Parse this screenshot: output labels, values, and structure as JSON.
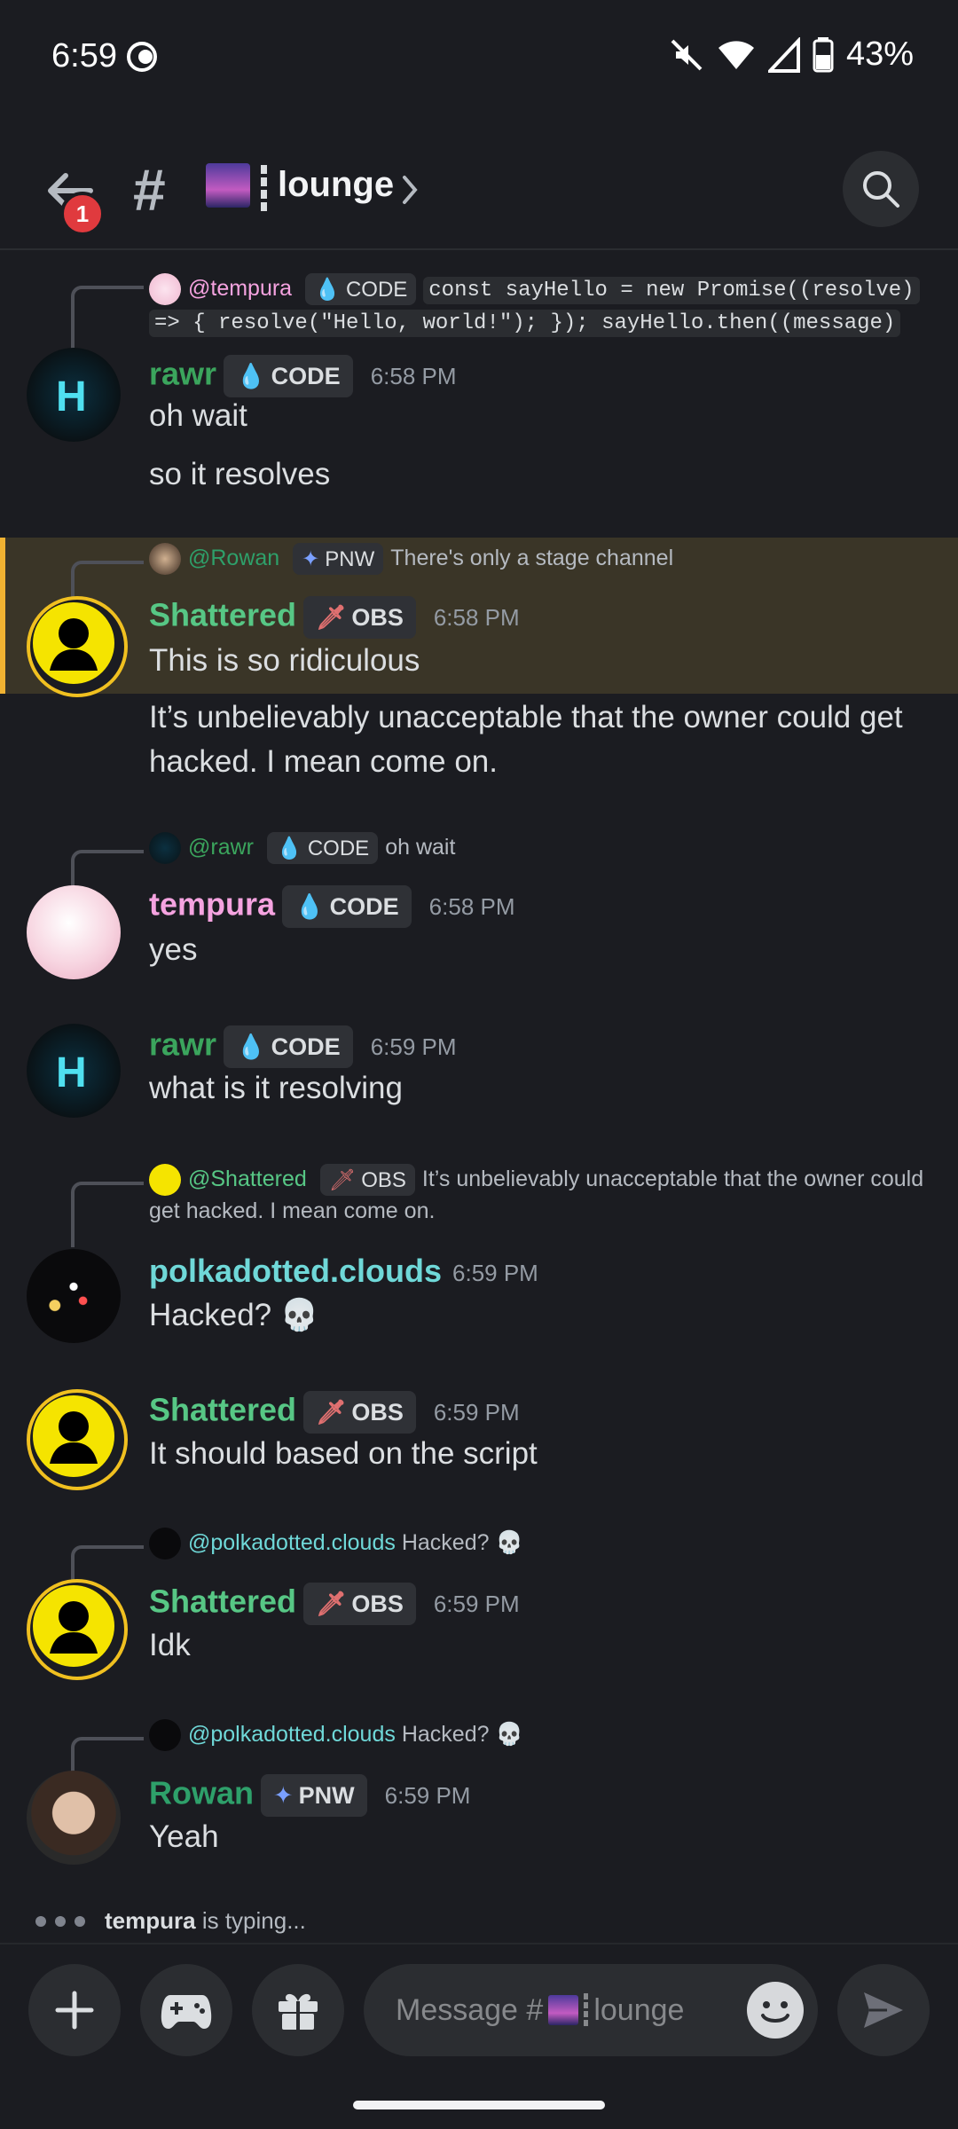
{
  "status": {
    "time": "6:59",
    "battery": "43%"
  },
  "header": {
    "badge_count": "1",
    "channel_name": "lounge"
  },
  "messages": {
    "m1": {
      "reply_user": "@tempura",
      "reply_tag": "CODE",
      "reply_text_line1": "const sayHello = new Promise((resolve)",
      "reply_text_line2": "=> {   resolve(\"Hello, world!\"); });  sayHello.then((message)",
      "user": "rawr",
      "tag": "CODE",
      "time": "6:58 PM",
      "lines": [
        "oh wait",
        "so it resolves"
      ]
    },
    "m2": {
      "reply_user": "@Rowan",
      "reply_tag": "PNW",
      "reply_text": "There's only a stage channel",
      "user": "Shattered",
      "tag": "OBS",
      "time": "6:58 PM",
      "line1": "This is so ridiculous",
      "line2": "It’s unbelievably unacceptable that the owner could get hacked. I mean come on."
    },
    "m3": {
      "reply_user": "@rawr",
      "reply_tag": "CODE",
      "reply_text": "oh wait",
      "user": "tempura",
      "tag": "CODE",
      "time": "6:58 PM",
      "line1": "yes"
    },
    "m4": {
      "user": "rawr",
      "tag": "CODE",
      "time": "6:59 PM",
      "line1": "what is it resolving"
    },
    "m5": {
      "reply_user": "@Shattered",
      "reply_tag": "OBS",
      "reply_text": "It’s unbelievably unacceptable that the owner could get hacked. I mean come on.",
      "user": "polkadotted.clouds",
      "time": "6:59 PM",
      "line1": "Hacked? 💀"
    },
    "m6": {
      "user": "Shattered",
      "tag": "OBS",
      "time": "6:59 PM",
      "line1": "It should based on the script"
    },
    "m7": {
      "reply_user": "@polkadotted.clouds",
      "reply_text": "Hacked? 💀",
      "user": "Shattered",
      "tag": "OBS",
      "time": "6:59 PM",
      "line1": "Idk"
    },
    "m8": {
      "reply_user": "@polkadotted.clouds",
      "reply_text": "Hacked? 💀",
      "user": "Rowan",
      "tag": "PNW",
      "time": "6:59 PM",
      "line1": "Yeah"
    }
  },
  "typing": {
    "user": "tempura",
    "suffix": "is typing..."
  },
  "composer": {
    "placeholder_prefix": "Message #",
    "placeholder_channel": "lounge"
  },
  "colors": {
    "rawr": "#3ba55d",
    "shattered": "#57c785",
    "tempura": "#f5a3e0",
    "polka": "#6fd8d8",
    "rowan": "#2ea06a",
    "highlight": "#f0b232"
  },
  "icons": [
    "back-arrow-icon",
    "hash-icon",
    "search-icon",
    "plus-icon",
    "gamepad-icon",
    "gift-icon",
    "emoji-icon",
    "send-icon"
  ]
}
